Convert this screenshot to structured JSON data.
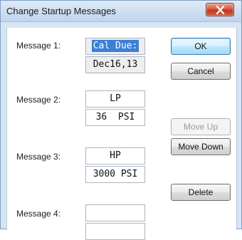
{
  "window": {
    "title": "Change Startup Messages"
  },
  "messages": [
    {
      "label": "Message 1:",
      "line1": "Cal Due:",
      "line2": "Dec16,13"
    },
    {
      "label": "Message 2:",
      "line1": "LP",
      "line2": "36  PSI"
    },
    {
      "label": "Message 3:",
      "line1": "HP",
      "line2": "3000 PSI"
    },
    {
      "label": "Message 4:",
      "line1": "",
      "line2": ""
    }
  ],
  "buttons": {
    "ok": "OK",
    "cancel": "Cancel",
    "move_up": "Move Up",
    "move_down": "Move Down",
    "delete": "Delete"
  },
  "colors": {
    "title_bar": "#cfdff1",
    "close_button": "#c7412a",
    "selection": "#3c80d6",
    "default_button": "#bee6fd"
  }
}
